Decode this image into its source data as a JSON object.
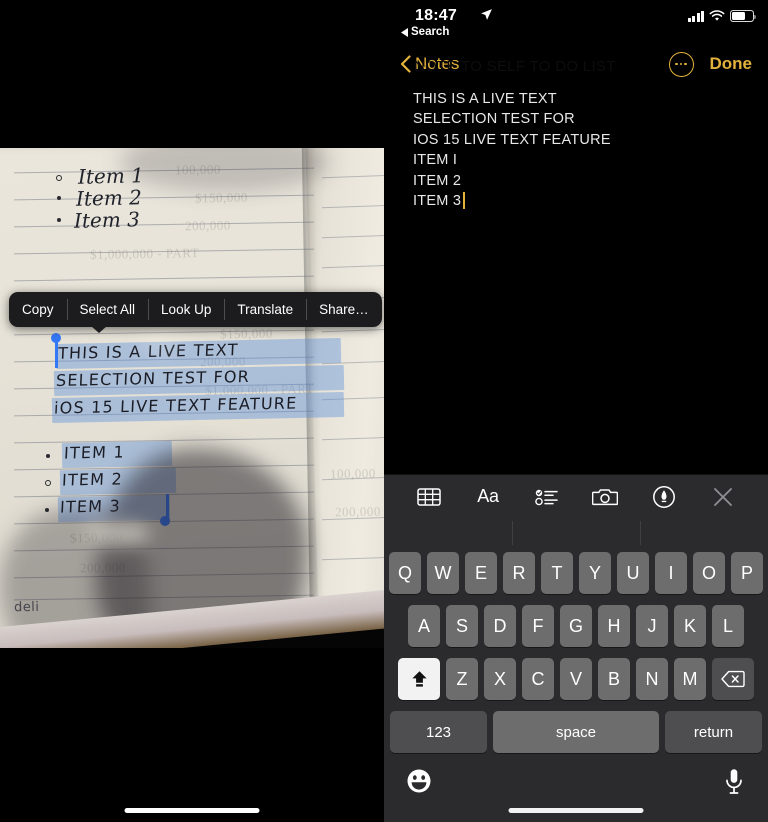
{
  "left": {
    "name": "live-text-photo-panel",
    "photo": {
      "notebook_brand": "deli",
      "cursive_lines": [
        "Item 1",
        "Item 2",
        "Item 3"
      ],
      "handwritten_block": [
        "THIS IS A LIVE TEXT",
        "SELECTION TEST FOR",
        "iOS 15 LIVE TEXT FEATURE"
      ],
      "handwritten_items": [
        "ITEM 1",
        "ITEM 2",
        "ITEM 3"
      ],
      "ghost_text": [
        "100,000",
        "$150,000",
        "200,000",
        "$1,000,000 - PART"
      ]
    },
    "context_menu": {
      "items": [
        {
          "label": "Copy",
          "name": "copy"
        },
        {
          "label": "Select All",
          "name": "select-all"
        },
        {
          "label": "Look Up",
          "name": "look-up"
        },
        {
          "label": "Translate",
          "name": "translate"
        },
        {
          "label": "Share…",
          "name": "share"
        }
      ]
    },
    "selection_color": "#3478f6",
    "highlight_color": "rgba(86,140,220,0.40)"
  },
  "right": {
    "name": "notes-app-panel",
    "status_bar": {
      "time": "18:47",
      "location_icon": "location-arrow-icon",
      "back_label": "Search",
      "back_icon": "back-triangle-icon",
      "signal_icon": "cellular-signal-icon",
      "wifi_icon": "wifi-icon",
      "battery_icon": "battery-icon",
      "battery_percent": 65
    },
    "nav_bar": {
      "back_label": "Notes",
      "back_icon": "chevron-left-icon",
      "more_icon": "more-ellipsis-circle-icon",
      "done_label": "Done",
      "accent_color": "#e3b23c"
    },
    "note": {
      "lines": [
        "THIS IS A LIVE TEXT",
        "SELECTION TEST FOR",
        "IOS 15 LIVE TEXT FEATURE",
        "ITEM I",
        "ITEM 2",
        "ITEM 3"
      ],
      "cursor_after_line": 5,
      "ghost_scrolled_text": "NOTE TO SELF TO DO LIST"
    },
    "keyboard_toolbar": {
      "items": [
        {
          "name": "table-icon",
          "label": ""
        },
        {
          "name": "text-format-aa-icon",
          "label": "Aa"
        },
        {
          "name": "checklist-icon",
          "label": ""
        },
        {
          "name": "camera-icon",
          "label": ""
        },
        {
          "name": "markup-pen-icon",
          "label": ""
        },
        {
          "name": "close-icon",
          "label": ""
        }
      ]
    },
    "keyboard": {
      "row1": [
        "Q",
        "W",
        "E",
        "R",
        "T",
        "Y",
        "U",
        "I",
        "O",
        "P"
      ],
      "row2": [
        "A",
        "S",
        "D",
        "F",
        "G",
        "H",
        "J",
        "K",
        "L"
      ],
      "row3": [
        "Z",
        "X",
        "C",
        "V",
        "B",
        "N",
        "M"
      ],
      "shift_label": "shift-key",
      "shift_active": true,
      "backspace_label": "backspace-key",
      "numbers_label": "123",
      "space_label": "space",
      "return_label": "return",
      "emoji_icon": "emoji-smiley-icon",
      "mic_icon": "microphone-icon"
    }
  }
}
